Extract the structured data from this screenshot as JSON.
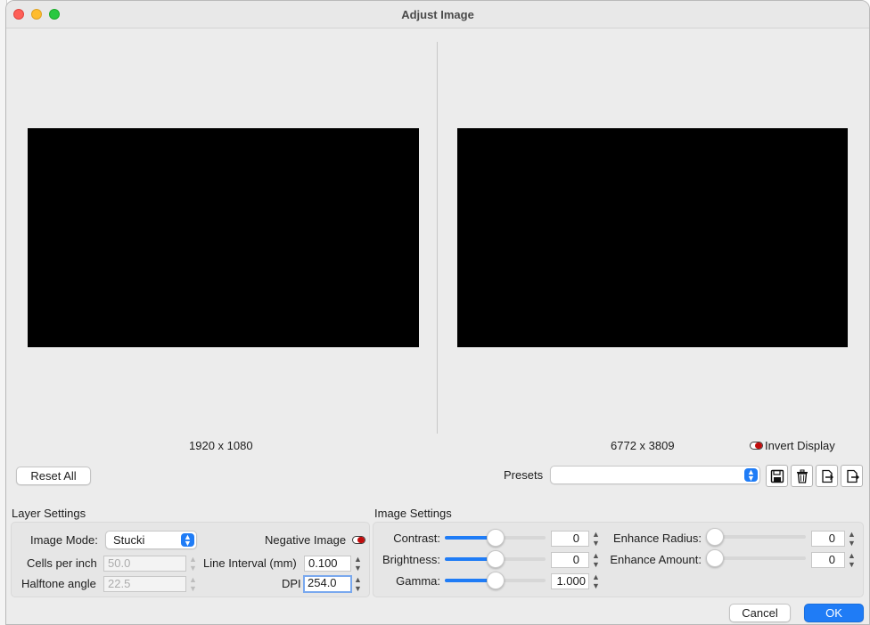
{
  "window": {
    "title": "Adjust Image"
  },
  "previews": {
    "original_dims": "1920 x 1080",
    "processed_dims": "6772 x 3809",
    "invert_display_label": "Invert Display"
  },
  "toolbar": {
    "reset_all_label": "Reset All",
    "presets_label": "Presets",
    "presets_value": ""
  },
  "layer_settings": {
    "title": "Layer Settings",
    "image_mode_label": "Image Mode:",
    "image_mode_value": "Stucki",
    "negative_image_label": "Negative Image",
    "cells_per_inch_label": "Cells per inch",
    "cells_per_inch_value": "50.0",
    "halftone_angle_label": "Halftone angle",
    "halftone_angle_value": "22.5",
    "line_interval_label": "Line Interval (mm)",
    "line_interval_value": "0.100",
    "dpi_label": "DPI",
    "dpi_value": "254.0"
  },
  "image_settings": {
    "title": "Image Settings",
    "contrast_label": "Contrast:",
    "contrast_value": "0",
    "contrast_level": 0.5,
    "brightness_label": "Brightness:",
    "brightness_value": "0",
    "brightness_level": 0.5,
    "gamma_label": "Gamma:",
    "gamma_value": "1.000",
    "gamma_level": 0.5,
    "enhance_radius_label": "Enhance Radius:",
    "enhance_radius_value": "0",
    "enhance_radius_level": 0.0,
    "enhance_amount_label": "Enhance Amount:",
    "enhance_amount_value": "0",
    "enhance_amount_level": 0.0
  },
  "footer": {
    "cancel_label": "Cancel",
    "ok_label": "OK"
  },
  "colors": {
    "accent": "#1f7cf6",
    "toggle_red": "#c10c0c",
    "preview": "#000000"
  }
}
